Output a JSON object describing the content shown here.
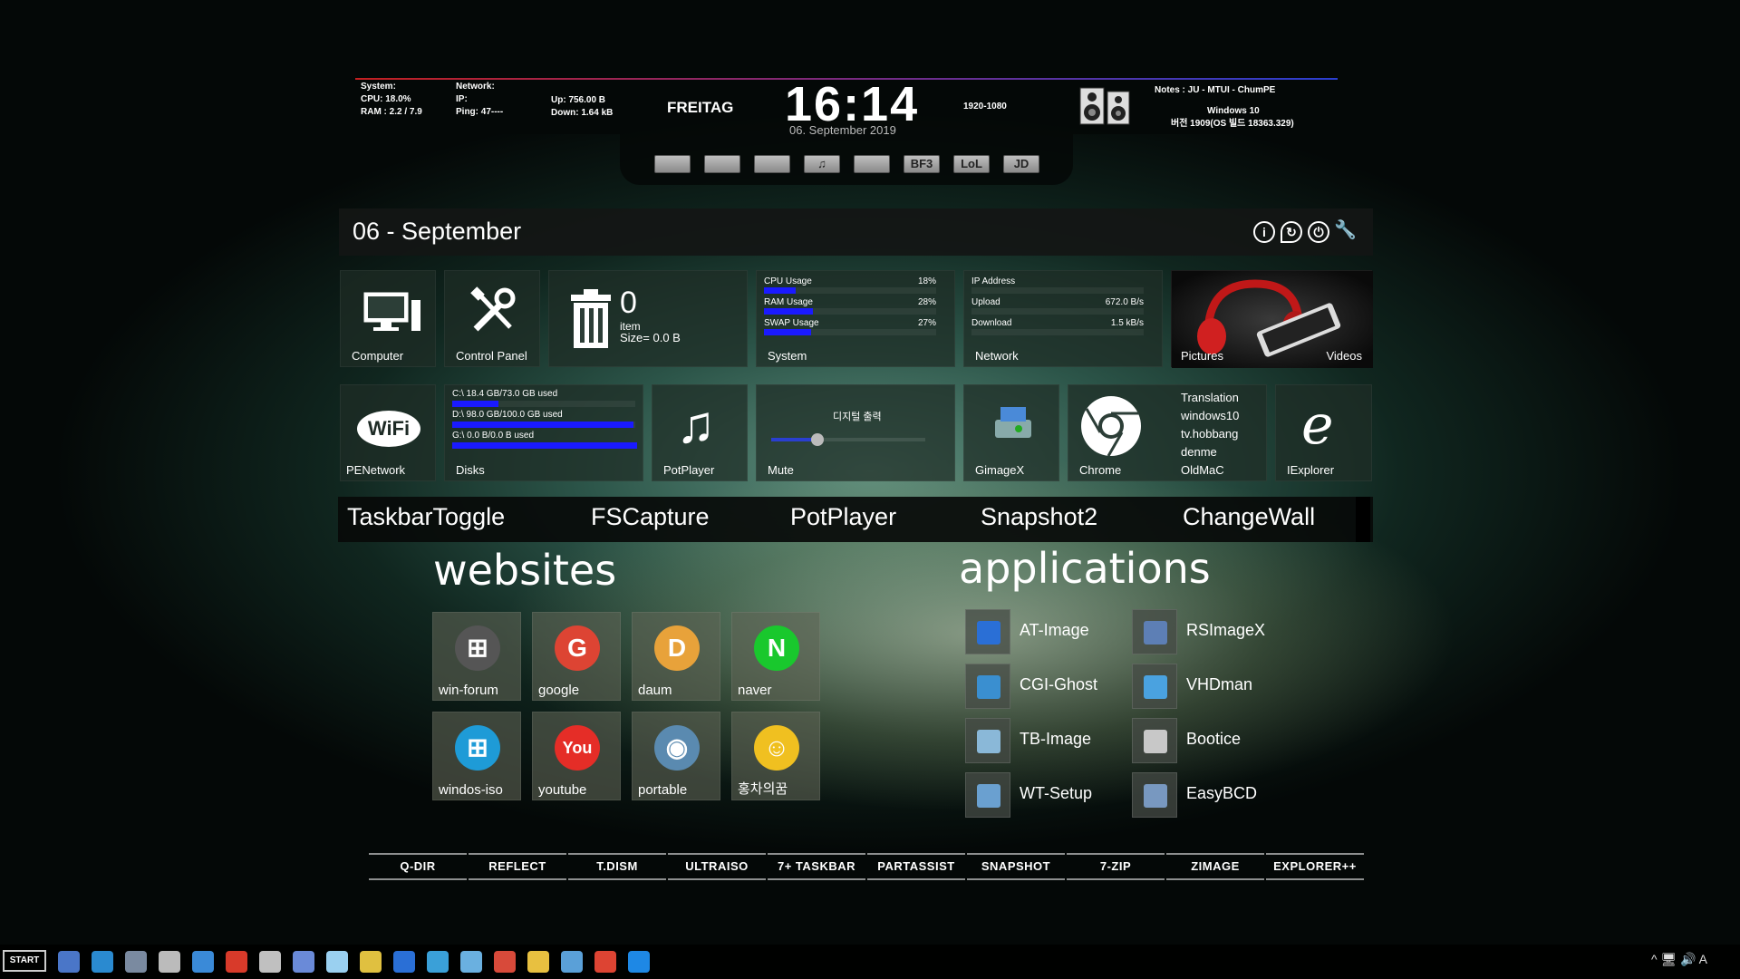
{
  "topbar": {
    "system_label": "System:",
    "cpu": "CPU: 18.0%",
    "ram": "RAM : 2.2 / 7.9",
    "network_label": "Network:",
    "ip": "IP:",
    "ping": "Ping: 47----",
    "up": "Up: 756.00 B",
    "down": "Down: 1.64 kB",
    "day": "FREITAG",
    "time": "16:14",
    "date": "06. September 2019",
    "resolution": "1920-1080",
    "notes": "Notes : JU - MTUI - ChumPE",
    "os": "Windows 10",
    "build": "버전 1909(OS 빌드 18363.329)"
  },
  "dock": {
    "icons": [
      "monitor-icon",
      "tools-icon",
      "gamepad-icon",
      "music-icon",
      "runner-icon",
      "bf3-icon",
      "lol-icon",
      "jd-icon"
    ],
    "labels": [
      "",
      "",
      "",
      "♫",
      "",
      "BF3",
      "LoL",
      "JD"
    ]
  },
  "header": {
    "date": "06  - September"
  },
  "tiles": {
    "computer": "Computer",
    "control_panel": "Control Panel",
    "recycle_count": "0",
    "recycle_item": "item",
    "recycle_size": "Size= 0.0 B",
    "system_label": "System",
    "network_label": "Network",
    "pictures": "Pictures",
    "videos": "Videos",
    "penetwork": "PENetwork",
    "disks": "Disks",
    "potplayer": "PotPlayer",
    "mute": "Mute",
    "audio_device": "디지털 출력",
    "gimagex": "GimageX",
    "chrome": "Chrome",
    "iexplorer": "IExplorer"
  },
  "system_stats": [
    {
      "label": "CPU Usage",
      "value": "18%",
      "fraction": 0.18
    },
    {
      "label": "RAM Usage",
      "value": "28%",
      "fraction": 0.28
    },
    {
      "label": "SWAP Usage",
      "value": "27%",
      "fraction": 0.27
    }
  ],
  "network_stats": [
    {
      "label": "IP Address",
      "value": ""
    },
    {
      "label": "Upload",
      "value": "672.0 B/s"
    },
    {
      "label": "Download",
      "value": "1.5 kB/s"
    }
  ],
  "disks": [
    {
      "label": "C:\\  18.4 GB/73.0 GB used",
      "fraction": 0.25
    },
    {
      "label": "D:\\  98.0 GB/100.0 GB used",
      "fraction": 0.98
    },
    {
      "label": "G:\\  0.0 B/0.0 B used",
      "fraction": 1.0
    }
  ],
  "mute_level": 0.3,
  "links": [
    "Translation",
    "windows10",
    "tv.hobbang",
    "denme",
    "OldMaC"
  ],
  "launcher": [
    "TaskbarToggle",
    "FSCapture",
    "PotPlayer",
    "Snapshot2",
    "ChangeWall"
  ],
  "websites": {
    "title": "websites",
    "items": [
      {
        "label": "win-forum",
        "icon": "windows-flag-icon"
      },
      {
        "label": "google",
        "icon": "google-icon"
      },
      {
        "label": "daum",
        "icon": "daum-icon"
      },
      {
        "label": "naver",
        "icon": "naver-icon"
      },
      {
        "label": "windos-iso",
        "icon": "windows-iso-icon"
      },
      {
        "label": "youtube",
        "icon": "youtube-icon"
      },
      {
        "label": "portable",
        "icon": "portable-icon"
      },
      {
        "label": "홍차의꿈",
        "icon": "profile-photo-icon"
      }
    ],
    "glyphs": [
      "⊞",
      "G",
      "D",
      "N",
      "⊞",
      "You",
      "◉",
      "☺"
    ],
    "colors": [
      "#555555",
      "#dd4433",
      "#e8a23a",
      "#19c82d",
      "#1e9bd7",
      "#e52d27",
      "#5a8ab0",
      "#f0c020"
    ]
  },
  "applications": {
    "title": "applications",
    "items": [
      {
        "label": "AT-Image",
        "icon": "at-image-icon",
        "color": "#2a6fd6"
      },
      {
        "label": "RSImageX",
        "icon": "rsimagex-icon",
        "color": "#5d7fb5"
      },
      {
        "label": "CGI-Ghost",
        "icon": "cgi-ghost-icon",
        "color": "#3a8fd0"
      },
      {
        "label": "VHDman",
        "icon": "vhdman-icon",
        "color": "#4aa2e0"
      },
      {
        "label": "TB-Image",
        "icon": "tb-image-icon",
        "color": "#8ab8d8"
      },
      {
        "label": "Bootice",
        "icon": "bootice-icon",
        "color": "#c8c8c8"
      },
      {
        "label": "WT-Setup",
        "icon": "wt-setup-icon",
        "color": "#6aa0d0"
      },
      {
        "label": "EasyBCD",
        "icon": "easybcd-icon",
        "color": "#7898c0"
      }
    ]
  },
  "quickbar": [
    "Q-DIR",
    "REFLECT",
    "T.DISM",
    "ULTRAISO",
    "7+ TASKBAR",
    "PARTASSIST",
    "SNAPSHOT",
    "7-ZIP",
    "ZIMAGE",
    "EXPLORER++"
  ],
  "taskbar": {
    "start": "START",
    "icons": [
      "user-icon",
      "circle-icon",
      "computer-icon",
      "usb-icon",
      "network-icon",
      "media-icon",
      "disc-icon",
      "rocket-icon",
      "file-icon",
      "apps-icon",
      "text-a-icon",
      "box-icon",
      "install-icon",
      "frame-icon",
      "folder-icon",
      "monitor-icon",
      "chrome-icon",
      "ie-icon"
    ],
    "colors": [
      "#4a76c8",
      "#2a8ad0",
      "#7a8aa0",
      "#bbbbbb",
      "#3a8ad8",
      "#d83a2a",
      "#c0c0c0",
      "#6a8ad8",
      "#9ad0f0",
      "#e0c040",
      "#2a6fd6",
      "#3aa0d8",
      "#6ab0e0",
      "#d84a3a",
      "#e8c040",
      "#5aa0d8",
      "#dd4433",
      "#1e88e5"
    ],
    "tray": "^ 🖥 🔊 A"
  }
}
